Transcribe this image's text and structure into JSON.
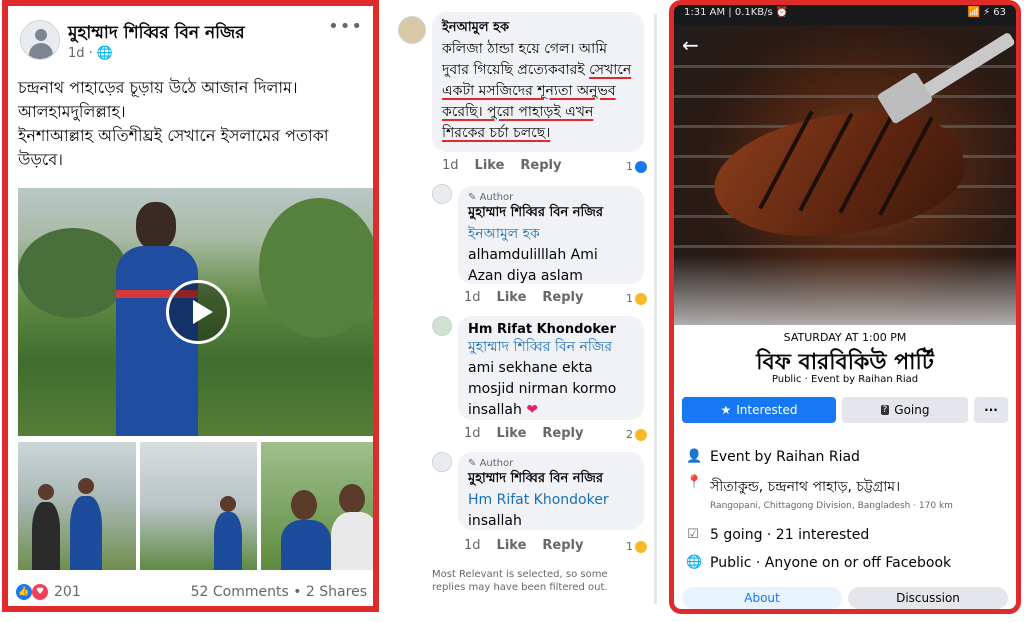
{
  "post": {
    "author": "মুহাম্মাদ শিব্বির বিন নজির",
    "time": "1d · ",
    "globe_icon": "globe-icon",
    "more": "•••",
    "lines": [
      "চন্দ্রনাথ পাহাড়ের চূড়ায় উঠে আজান দিলাম।",
      "আলহামদুলিল্লাহ।",
      "ইনশাআল্লাহ অতিশীঘ্রই সেখানে ইসলামের পতাকা উড়বে।"
    ],
    "reaction_count": "201",
    "stats": "52 Comments • 2 Shares"
  },
  "comments": {
    "c1": {
      "name": "ইনআমুল হক",
      "text_a": "কলিজা ঠান্ডা হয়ে গেল। আমি দুবার গিয়েছি প্রত্যেকবারই",
      "text_b": "সেখানে একটা মসজিদের শূন্যতা অনুভব করেছি। পুরো পাহাড়ই এখন শিরকের চর্চা চলছে।",
      "time": "1d",
      "like": "Like",
      "reply": "Reply",
      "count": "1"
    },
    "c2": {
      "author_label": "Author",
      "name": "মুহাম্মাদ শিব্বির বিন নজির",
      "tag": "ইনআমুল হক",
      "text": "alhamdulilllah Ami Azan diya aslam",
      "time": "1d",
      "like": "Like",
      "reply": "Reply",
      "count": "1"
    },
    "c3": {
      "name": "Hm Rifat Khondoker",
      "tag": "মুহাম্মাদ শিব্বির বিন নজির",
      "text": "ami sekhane ekta mosjid nirman kormo insallah",
      "emoji": "❤",
      "time": "1d",
      "like": "Like",
      "reply": "Reply",
      "count": "2"
    },
    "c4": {
      "author_label": "Author",
      "name": "মুহাম্মাদ শিব্বির বিন নজির",
      "tag": "Hm Rifat Khondoker",
      "text": "insallah",
      "time": "1d",
      "like": "Like",
      "reply": "Reply",
      "count": "1"
    },
    "footer": "Most Relevant is selected, so some replies may have been filtered out."
  },
  "event": {
    "status_time": "1:31 AM | 0.1KB/s ⏰",
    "status_right": "📶 ⚡ 63",
    "date": "SATURDAY AT 1:00 PM",
    "title": "বিফ বারবিকিউ পার্টি",
    "subtitle": "Public · Event by Raihan Riad",
    "interested": "Interested",
    "going": "Going",
    "more": "···",
    "host": "Event by Raihan Riad",
    "location": "সীতাকুন্ড, চন্দ্রনাথ পাহাড়, চট্টগ্রাম।",
    "location_sub": "Rangopani, Chittagong Division, Bangladesh · 170 km",
    "attendance": "5 going · 21 interested",
    "privacy": "Public · Anyone on or off Facebook",
    "tab_about": "About",
    "tab_discussion": "Discussion"
  }
}
